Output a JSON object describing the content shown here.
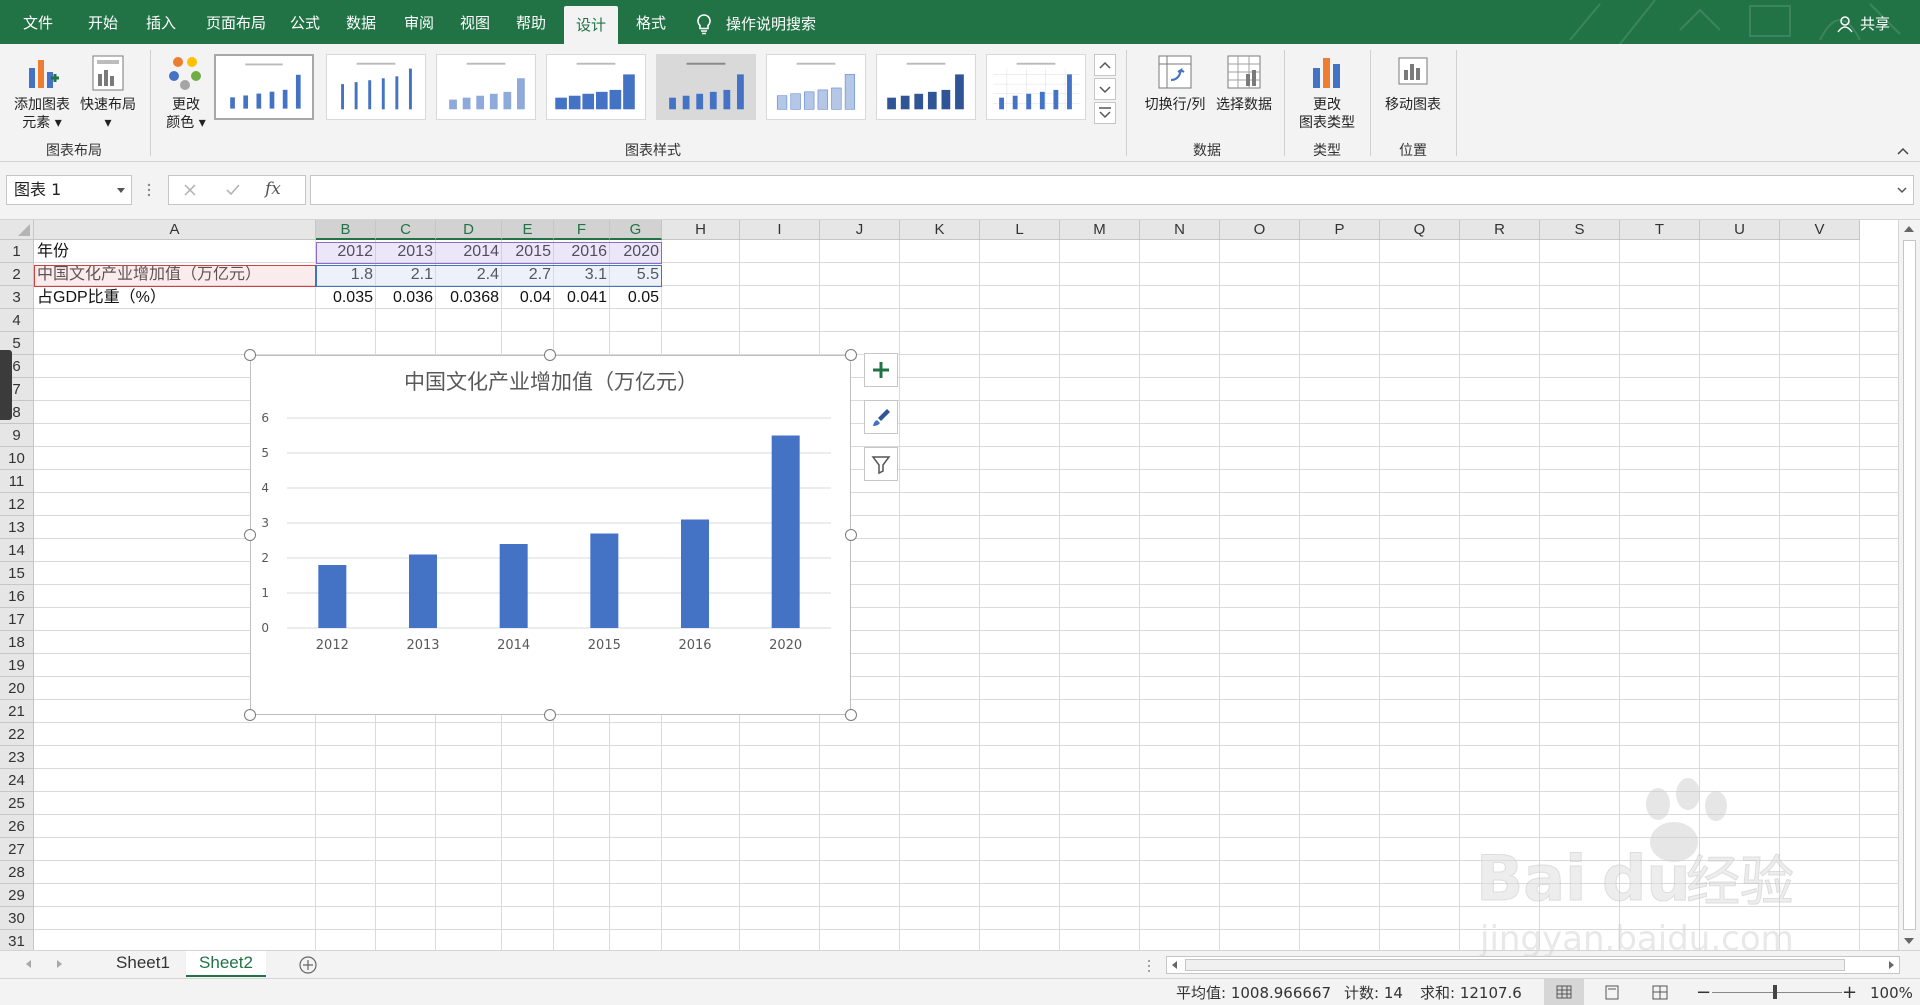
{
  "tabs": [
    {
      "label": "文件"
    },
    {
      "label": "开始"
    },
    {
      "label": "插入"
    },
    {
      "label": "页面布局"
    },
    {
      "label": "公式"
    },
    {
      "label": "数据"
    },
    {
      "label": "审阅"
    },
    {
      "label": "视图"
    },
    {
      "label": "帮助"
    },
    {
      "label": "设计"
    },
    {
      "label": "格式"
    }
  ],
  "active_tab": "设计",
  "tell_me": "操作说明搜索",
  "share": "共享",
  "ribbon": {
    "add_element_line1": "添加图表",
    "add_element_line2": "元素",
    "quick_layout_line1": "快速布局",
    "change_color_line1": "更改",
    "change_color_line2": "颜色",
    "group_chart_layout": "图表布局",
    "group_chart_styles": "图表样式",
    "switch_row_col": "切换行/列",
    "select_data": "选择数据",
    "group_data": "数据",
    "change_type_line1": "更改",
    "change_type_line2": "图表类型",
    "group_type": "类型",
    "move_chart": "移动图表",
    "group_location": "位置"
  },
  "namebox": "图表 1",
  "fx": "fx",
  "columns": [
    "A",
    "B",
    "C",
    "D",
    "E",
    "F",
    "G",
    "H",
    "I",
    "J",
    "K",
    "L",
    "M",
    "N",
    "O",
    "P",
    "Q",
    "R",
    "S",
    "T",
    "U",
    "V"
  ],
  "rows": [
    "1",
    "2",
    "3",
    "4",
    "5",
    "6",
    "7",
    "8",
    "9",
    "10",
    "11",
    "12",
    "13",
    "14",
    "15",
    "16",
    "17",
    "18",
    "19",
    "20",
    "21",
    "22",
    "23",
    "24",
    "25",
    "26",
    "27",
    "28",
    "29",
    "30",
    "31"
  ],
  "cells": {
    "r1": {
      "A": "年份",
      "B": "2012",
      "C": "2013",
      "D": "2014",
      "E": "2015",
      "F": "2016",
      "G": "2020"
    },
    "r2": {
      "A": "中国文化产业增加值（万亿元）",
      "B": "1.8",
      "C": "2.1",
      "D": "2.4",
      "E": "2.7",
      "F": "3.1",
      "G": "5.5"
    },
    "r3": {
      "A": "占GDP比重（%）",
      "B": "0.035",
      "C": "0.036",
      "D": "0.0368",
      "E": "0.04",
      "F": "0.041",
      "G": "0.05"
    }
  },
  "chart_data": {
    "type": "bar",
    "title": "中国文化产业增加值（万亿元）",
    "categories": [
      "2012",
      "2013",
      "2014",
      "2015",
      "2016",
      "2020"
    ],
    "values": [
      1.8,
      2.1,
      2.4,
      2.7,
      3.1,
      5.5
    ],
    "ylim": [
      0,
      6
    ],
    "yticks": [
      "0",
      "1",
      "2",
      "3",
      "4",
      "5",
      "6"
    ],
    "grid": true,
    "bar_color": "#4472c4"
  },
  "sheets": [
    {
      "name": "Sheet1"
    },
    {
      "name": "Sheet2"
    }
  ],
  "active_sheet": "Sheet2",
  "status": {
    "average": "平均值: 1008.966667",
    "count": "计数: 14",
    "sum": "求和: 12107.6",
    "zoom": "100%"
  },
  "colors": {
    "excel_green": "#217346",
    "bar": "#4472c4"
  }
}
